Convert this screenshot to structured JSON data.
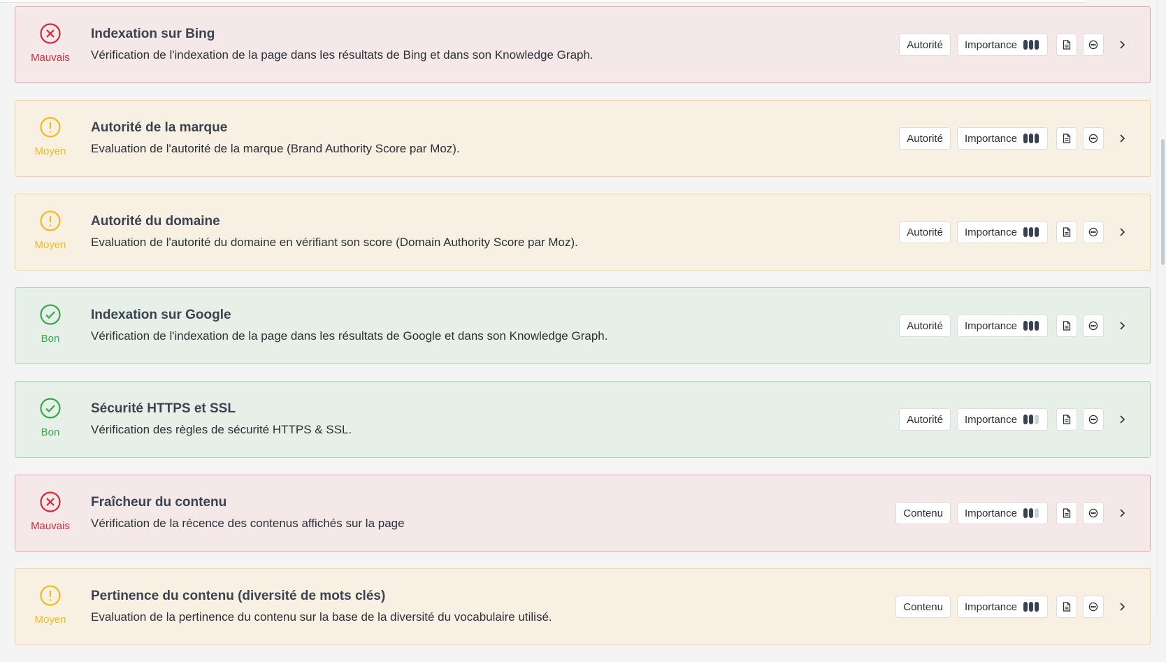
{
  "labels": {
    "importance": "Importance"
  },
  "colors": {
    "bad": "#d42a3c",
    "mid": "#f0bc1a",
    "good": "#36a84a"
  },
  "items": [
    {
      "status": "bad",
      "status_label": "Mauvais",
      "title": "Indexation sur Bing",
      "description": "Vérification de l'indexation de la page dans les résultats de Bing et dans son Knowledge Graph.",
      "category": "Autorité",
      "importance": 3
    },
    {
      "status": "mid",
      "status_label": "Moyen",
      "title": "Autorité de la marque",
      "description": "Evaluation de l'autorité de la marque (Brand Authority Score par Moz).",
      "category": "Autorité",
      "importance": 3
    },
    {
      "status": "mid",
      "status_label": "Moyen",
      "title": "Autorité du domaine",
      "description": "Evaluation de l'autorité du domaine en vérifiant son score (Domain Authority Score par Moz).",
      "category": "Autorité",
      "importance": 3
    },
    {
      "status": "good",
      "status_label": "Bon",
      "title": "Indexation sur Google",
      "description": "Vérification de l'indexation de la page dans les résultats de Google et dans son Knowledge Graph.",
      "category": "Autorité",
      "importance": 3
    },
    {
      "status": "good",
      "status_label": "Bon",
      "title": "Sécurité HTTPS et SSL",
      "description": "Vérification des règles de sécurité HTTPS & SSL.",
      "category": "Autorité",
      "importance": 2
    },
    {
      "status": "bad",
      "status_label": "Mauvais",
      "title": "Fraîcheur du contenu",
      "description": "Vérification de la récence des contenus affichés sur la page",
      "category": "Contenu",
      "importance": 2
    },
    {
      "status": "mid",
      "status_label": "Moyen",
      "title": "Pertinence du contenu (diversité de mots clés)",
      "description": "Evaluation de la pertinence du contenu sur la base de la diversité du vocabulaire utilisé.",
      "category": "Contenu",
      "importance": 3
    }
  ]
}
